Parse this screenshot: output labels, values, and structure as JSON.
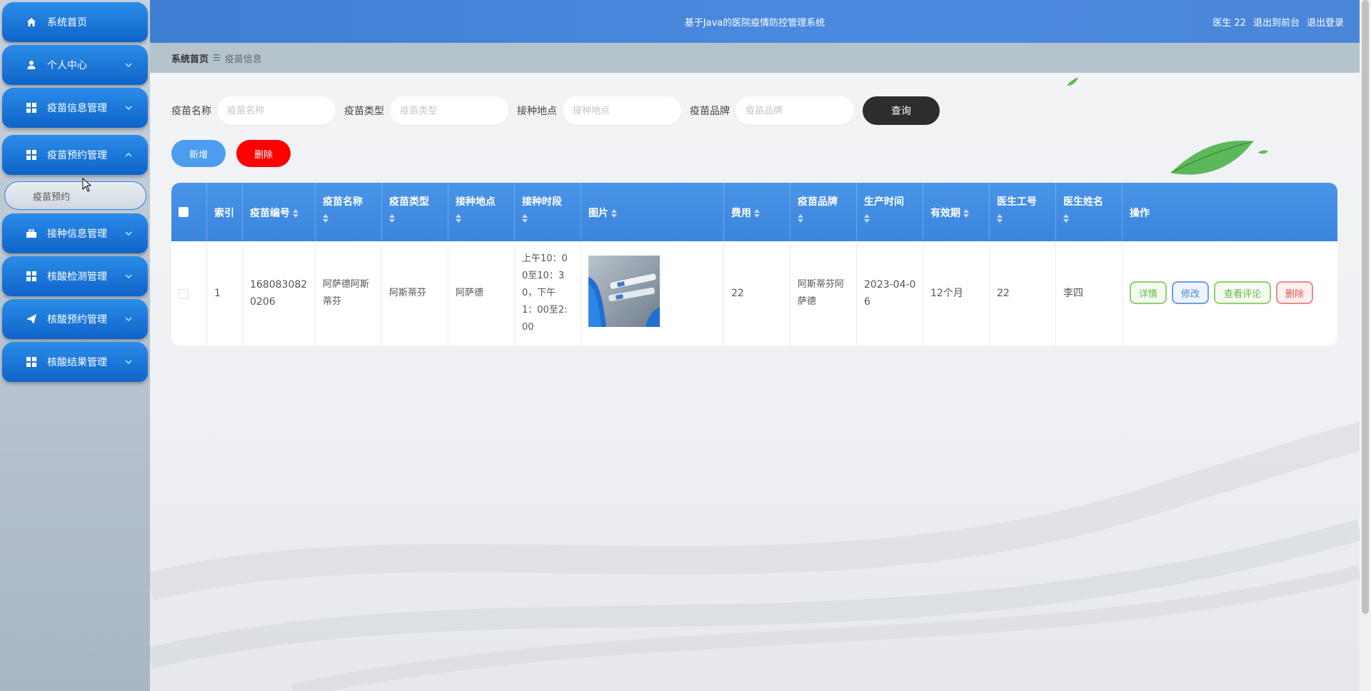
{
  "header": {
    "app_title": "基于Java的医院疫情防控管理系统",
    "user_name": "医生 22",
    "link_front": "退出到前台",
    "link_logout": "退出登录"
  },
  "sidebar": {
    "items": [
      {
        "label": "系统首页",
        "icon": "home-icon"
      },
      {
        "label": "个人中心",
        "icon": "user-icon"
      },
      {
        "label": "疫苗信息管理",
        "icon": "grid-icon"
      },
      {
        "label": "疫苗预约管理",
        "icon": "grid-icon"
      },
      {
        "label": "接种信息管理",
        "icon": "briefcase-icon"
      },
      {
        "label": "核酸检测管理",
        "icon": "grid-icon"
      },
      {
        "label": "核酸预约管理",
        "icon": "send-icon"
      },
      {
        "label": "核酸结果管理",
        "icon": "grid-icon"
      }
    ],
    "sub_item": "疫苗预约"
  },
  "breadcrumb": {
    "home": "系统首页",
    "current": "疫苗信息"
  },
  "search": {
    "fields": [
      {
        "label": "疫苗名称",
        "placeholder": "疫苗名称"
      },
      {
        "label": "疫苗类型",
        "placeholder": "疫苗类型"
      },
      {
        "label": "接种地点",
        "placeholder": "接种地点"
      },
      {
        "label": "疫苗品牌",
        "placeholder": "疫苗品牌"
      }
    ],
    "query_label": "查询"
  },
  "actions": {
    "add_label": "新增",
    "delete_label": "删除"
  },
  "table": {
    "headers": {
      "index": "索引",
      "code": "疫苗编号",
      "name": "疫苗名称",
      "type": "疫苗类型",
      "place": "接种地点",
      "period": "接种时段",
      "image": "图片",
      "fee": "费用",
      "brand": "疫苗品牌",
      "produced": "生产时间",
      "validity": "有效期",
      "doctor_id": "医生工号",
      "doctor_name": "医生姓名",
      "ops": "操作"
    },
    "rows": [
      {
        "index": "1",
        "code_l1": "168083082",
        "code_l2": "0206",
        "name_l1": "阿萨德阿斯",
        "name_l2": "蒂芬",
        "type": "阿斯蒂芬",
        "place": "阿萨德",
        "period_l1": "上午10：0",
        "period_l2": "0至10：3",
        "period_l3": "0，下午",
        "period_l4": "1：00至2:",
        "period_l5": "00",
        "fee": "22",
        "brand_l1": "阿斯蒂芬阿",
        "brand_l2": "萨德",
        "produced_l1": "2023-04-0",
        "produced_l2": "6",
        "validity": "12个月",
        "doctor_id": "22",
        "doctor_name": "李四"
      }
    ],
    "row_buttons": {
      "detail": "详情",
      "edit": "修改",
      "review": "查看评论",
      "delete": "删除"
    }
  },
  "colors": {
    "header_blue": "#4a86d8",
    "menu_blue": "#1a73d8",
    "delete_red": "#ff0000",
    "add_blue": "#4c9cf0",
    "query_dark": "#2d2d2d"
  }
}
